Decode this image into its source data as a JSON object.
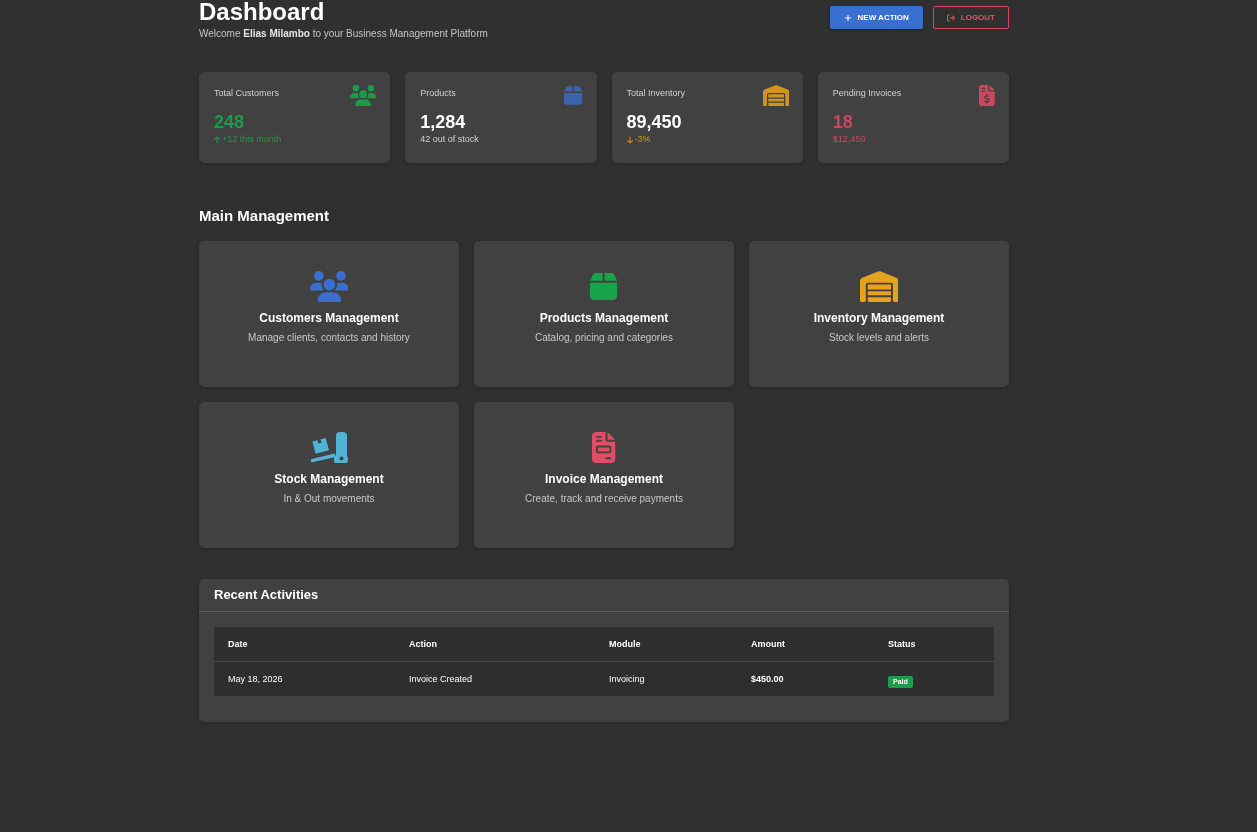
{
  "header": {
    "title": "Dashboard",
    "welcome": "Welcome **Elias Milambo** to your Business Management Platform",
    "buttons": [
      {
        "label": "NEW ACTION",
        "kind": "primary"
      },
      {
        "label": "LOGOUT",
        "kind": "danger"
      }
    ]
  },
  "stats": [
    {
      "label": "Total Customers",
      "value": "248",
      "note": "+12 this month",
      "kind": "up",
      "emphasis": true,
      "color": "#1f9a4b"
    },
    {
      "label": "Products",
      "value": "1,284",
      "note": "42 out of stock",
      "kind": "flat",
      "emphasis": false,
      "color": "#3c64ab"
    },
    {
      "label": "Total Inventory",
      "value": "89,450",
      "note": "-3%",
      "kind": "down",
      "emphasis": false,
      "color": "#d4931f"
    },
    {
      "label": "Pending Invoices",
      "value": "18",
      "note": "$12,450",
      "kind": "flat",
      "emphasis": true,
      "color": "#c9475f"
    }
  ],
  "main_management": {
    "title": "Main Management",
    "modules": [
      {
        "title": "Customers Management",
        "description": "Manage clients, contacts and history",
        "color": "#3a6fd0"
      },
      {
        "title": "Products Management",
        "description": "Catalog, pricing and categories",
        "color": "#18a24a"
      },
      {
        "title": "Inventory Management",
        "description": "Stock levels and alerts",
        "color": "#e6a21c"
      },
      {
        "title": "Stock Management",
        "description": "In & Out movements",
        "color": "#50b4d8"
      },
      {
        "title": "Invoice Management",
        "description": "Create, track and receive payments",
        "color": "#e04d65"
      }
    ]
  },
  "recent_activities": {
    "title": "Recent Activities",
    "columns": [
      "Date",
      "Action",
      "Module",
      "Amount",
      "Status"
    ],
    "rows": [
      {
        "cells": [
          "May 18, 2026",
          "Invoice Created",
          "Invoicing",
          "$450.00"
        ],
        "status": {
          "label": "Paid",
          "color": "#1e9e4a"
        }
      }
    ]
  }
}
